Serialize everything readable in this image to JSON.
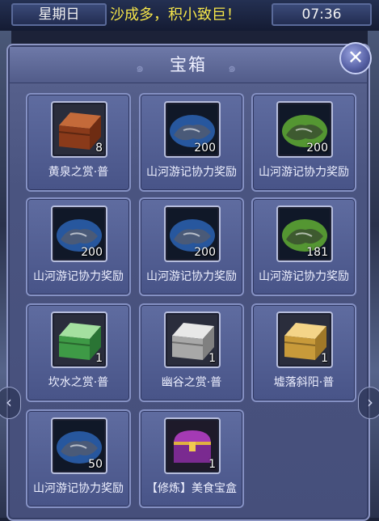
{
  "status_bar": {
    "day": "星期日",
    "marquee": "沙成多，积小致巨！",
    "time": "07:36"
  },
  "panel": {
    "title": "宝箱",
    "close_glyph": "✕"
  },
  "items": [
    {
      "name": "黄泉之赏·普",
      "count": "8",
      "icon": "red-treasure-chest-icon"
    },
    {
      "name": "山河游记协力奖励",
      "count": "200",
      "icon": "blue-handshake-icon"
    },
    {
      "name": "山河游记协力奖励",
      "count": "200",
      "icon": "green-handshake-icon"
    },
    {
      "name": "山河游记协力奖励",
      "count": "200",
      "icon": "blue-handshake-icon"
    },
    {
      "name": "山河游记协力奖励",
      "count": "200",
      "icon": "blue-handshake-icon"
    },
    {
      "name": "山河游记协力奖励",
      "count": "181",
      "icon": "green-handshake-icon"
    },
    {
      "name": "坎水之赏·普",
      "count": "1",
      "icon": "green-treasure-chest-icon"
    },
    {
      "name": "幽谷之赏·普",
      "count": "1",
      "icon": "silver-treasure-chest-icon"
    },
    {
      "name": "墟落斜阳·普",
      "count": "1",
      "icon": "gold-treasure-chest-icon"
    },
    {
      "name": "山河游记协力奖励",
      "count": "50",
      "icon": "blue-handshake-icon"
    },
    {
      "name": "【修炼】美食宝盒",
      "count": "1",
      "icon": "purple-food-box-icon"
    }
  ],
  "colors": {
    "marquee_text": "#f6e64a",
    "panel_bg": "#4a5480",
    "tile_border": "#8591c4"
  }
}
